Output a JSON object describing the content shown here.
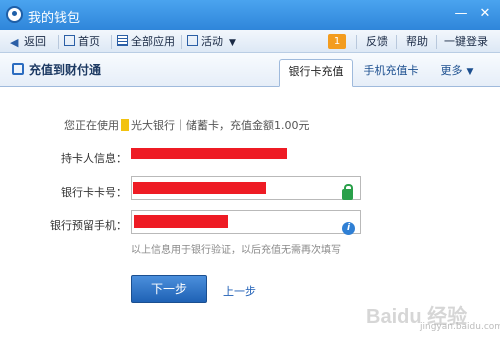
{
  "window": {
    "title": "我的钱包"
  },
  "toolbar": {
    "back": "返回",
    "home": "首页",
    "all_apps": "全部应用",
    "activities": "活动",
    "badge_count": "1",
    "feedback": "反馈",
    "help": "帮助",
    "one_click_login": "一键登录"
  },
  "page": {
    "title": "充值到财付通",
    "tabs": [
      {
        "label": "银行卡充值",
        "active": true
      },
      {
        "label": "手机充值卡",
        "active": false
      },
      {
        "label": "更多",
        "active": false
      }
    ]
  },
  "form": {
    "info_prefix": "您正在使用",
    "info_suffix": "光大银行｜储蓄卡，充值金额1.00元",
    "cardholder_label": "持卡人信息：",
    "card_number_label": "银行卡卡号：",
    "phone_label": "银行预留手机：",
    "hint": "以上信息用于银行验证，以后充值无需再次填写",
    "next_button": "下一步",
    "prev_link": "上一步"
  },
  "colors": {
    "titlebar": "#2f86da",
    "redaction": "#ee1b24",
    "primary_button": "#1f62b5"
  },
  "watermark": {
    "text": "Baidu 经验",
    "sub": "jingyan.baidu.com"
  }
}
